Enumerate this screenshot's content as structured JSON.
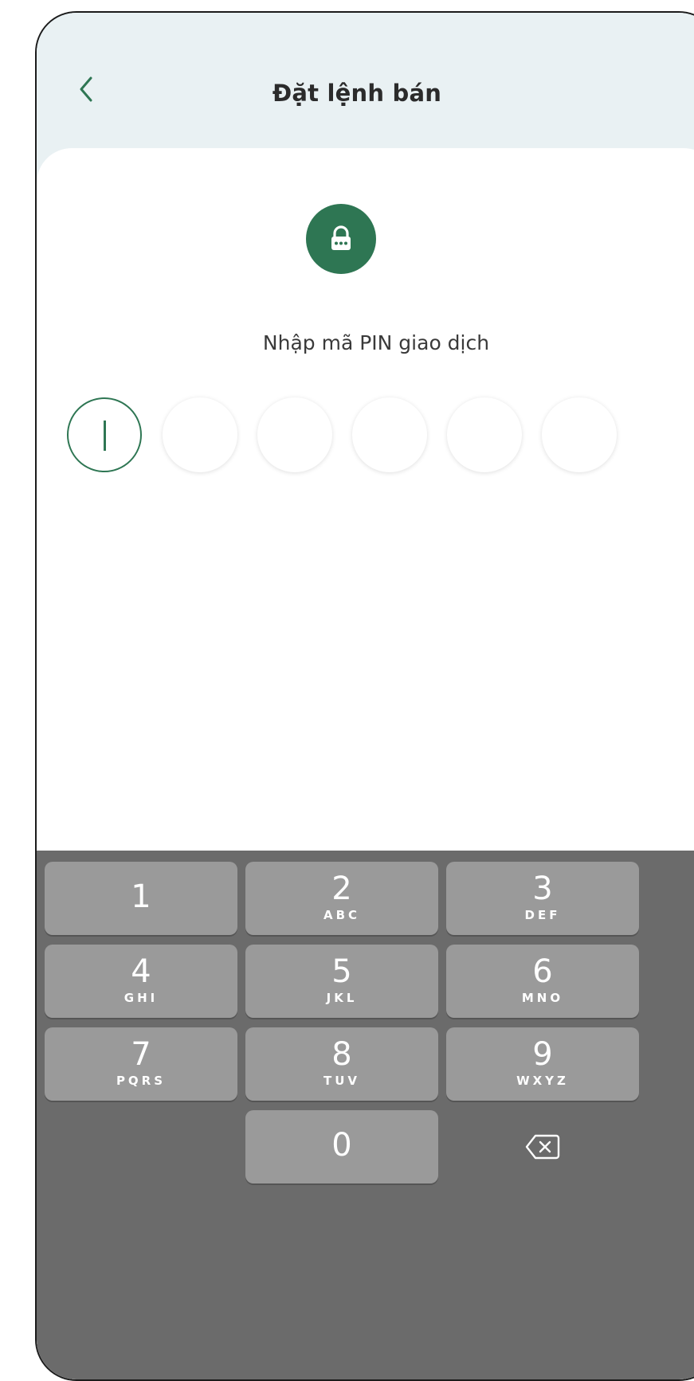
{
  "header": {
    "title": "Đặt lệnh bán",
    "back_icon": "chevron-left-icon"
  },
  "pin": {
    "lock_icon": "lock-icon",
    "prompt": "Nhập mã PIN giao dịch",
    "length": 6,
    "filled": 0
  },
  "keypad": {
    "keys": [
      {
        "digit": "1",
        "letters": ""
      },
      {
        "digit": "2",
        "letters": "ABC"
      },
      {
        "digit": "3",
        "letters": "DEF"
      },
      {
        "digit": "4",
        "letters": "GHI"
      },
      {
        "digit": "5",
        "letters": "JKL"
      },
      {
        "digit": "6",
        "letters": "MNO"
      },
      {
        "digit": "7",
        "letters": "PQRS"
      },
      {
        "digit": "8",
        "letters": "TUV"
      },
      {
        "digit": "9",
        "letters": "WXYZ"
      },
      {
        "digit": "0",
        "letters": ""
      }
    ],
    "delete_icon": "backspace-icon"
  },
  "colors": {
    "accent": "#2e7653",
    "header_bg": "#e9f1f3",
    "keypad_bg": "#6b6b6b",
    "key_bg": "#9a9a9a"
  }
}
